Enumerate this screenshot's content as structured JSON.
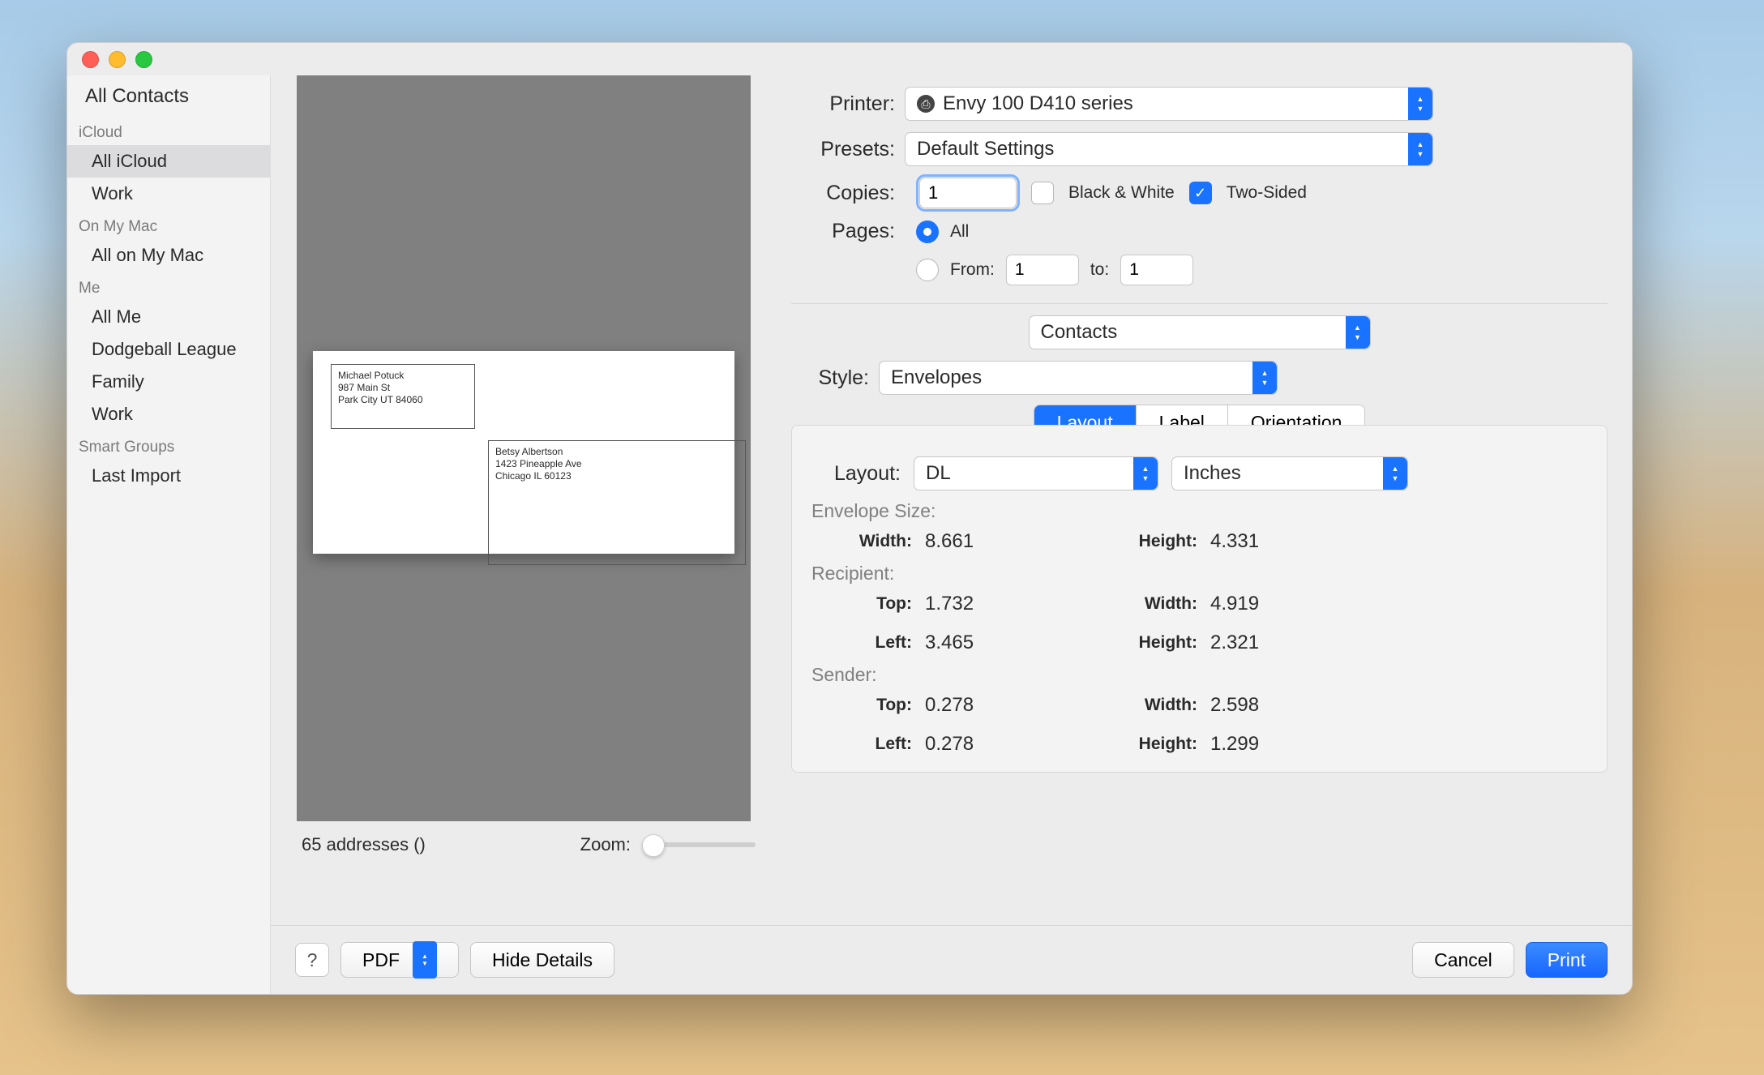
{
  "sidebar": {
    "all_contacts": "All Contacts",
    "groups": [
      {
        "header": "iCloud",
        "items": [
          {
            "label": "All iCloud",
            "selected": true
          },
          {
            "label": "Work",
            "selected": false
          }
        ]
      },
      {
        "header": "On My Mac",
        "items": [
          {
            "label": "All on My Mac",
            "selected": false
          }
        ]
      },
      {
        "header": "Me",
        "items": [
          {
            "label": "All Me",
            "selected": false
          },
          {
            "label": "Dodgeball League",
            "selected": false
          },
          {
            "label": "Family",
            "selected": false
          },
          {
            "label": "Work",
            "selected": false
          }
        ]
      },
      {
        "header": "Smart Groups",
        "items": [
          {
            "label": "Last Import",
            "selected": false
          }
        ]
      }
    ]
  },
  "preview": {
    "sender": {
      "name": "Michael Potuck",
      "street": "987 Main St",
      "city_line": "Park City UT 84060"
    },
    "recipient": {
      "name": "Betsy Albertson",
      "street": "1423 Pineapple Ave",
      "city_line": "Chicago IL 60123"
    },
    "status": "65 addresses ()",
    "zoom_label": "Zoom:"
  },
  "form": {
    "printer_label": "Printer:",
    "printer_value": "Envy 100 D410 series",
    "printer_icon": "printer-status-icon",
    "presets_label": "Presets:",
    "presets_value": "Default Settings",
    "copies_label": "Copies:",
    "copies_value": "1",
    "bw_label": "Black & White",
    "bw_checked": false,
    "twosided_label": "Two-Sided",
    "twosided_checked": true,
    "pages_label": "Pages:",
    "pages_all_label": "All",
    "pages_all_selected": true,
    "pages_from_label": "From:",
    "pages_from_value": "1",
    "pages_to_label": "to:",
    "pages_to_value": "1",
    "app_select": "Contacts",
    "style_label": "Style:",
    "style_value": "Envelopes",
    "tabs": {
      "layout": "Layout",
      "label": "Label",
      "orientation": "Orientation",
      "active": "layout"
    },
    "layout": {
      "layout_label": "Layout:",
      "size_preset": "DL",
      "units": "Inches",
      "envelope_size_header": "Envelope Size:",
      "recipient_header": "Recipient:",
      "sender_header": "Sender:",
      "k_width": "Width:",
      "k_height": "Height:",
      "k_top": "Top:",
      "k_left": "Left:",
      "envelope": {
        "width": "8.661",
        "height": "4.331"
      },
      "recipient": {
        "top": "1.732",
        "width": "4.919",
        "left": "3.465",
        "height": "2.321"
      },
      "sender": {
        "top": "0.278",
        "width": "2.598",
        "left": "0.278",
        "height": "1.299"
      }
    }
  },
  "footer": {
    "help": "?",
    "pdf": "PDF",
    "hide_details": "Hide Details",
    "cancel": "Cancel",
    "print": "Print"
  }
}
